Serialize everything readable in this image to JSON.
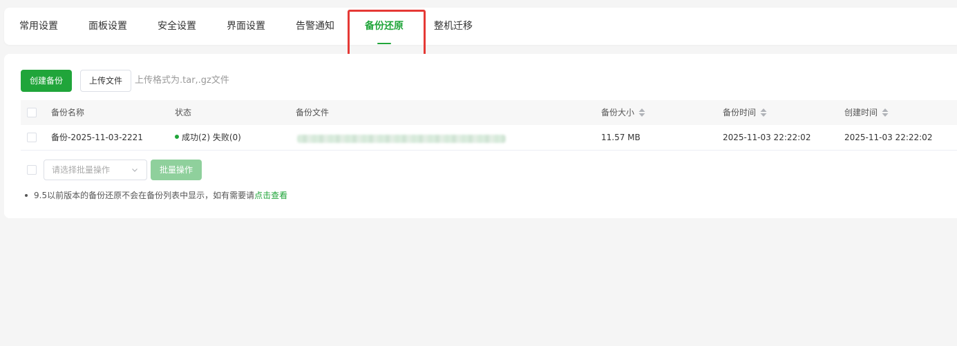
{
  "tabs": [
    {
      "label": "常用设置"
    },
    {
      "label": "面板设置"
    },
    {
      "label": "安全设置"
    },
    {
      "label": "界面设置"
    },
    {
      "label": "告警通知"
    },
    {
      "label": "备份还原"
    },
    {
      "label": "整机迁移"
    }
  ],
  "active_tab": "备份还原",
  "toolbar": {
    "create_label": "创建备份",
    "upload_label": "上传文件",
    "upload_hint": "上传格式为.tar,.gz文件"
  },
  "table": {
    "columns": {
      "name": "备份名称",
      "status": "状态",
      "file": "备份文件",
      "size": "备份大小",
      "backup_time": "备份时间",
      "create_time": "创建时间"
    },
    "rows": [
      {
        "name": "备份-2025-11-03-2221",
        "status": "成功(2) 失败(0)",
        "size": "11.57 MB",
        "backup_time": "2025-11-03 22:22:02",
        "create_time": "2025-11-03 22:22:02"
      }
    ]
  },
  "batch": {
    "placeholder": "请选择批量操作",
    "button_label": "批量操作"
  },
  "note": {
    "text": "9.5以前版本的备份还原不会在备份列表中显示，如有需要请",
    "link": "点击查看"
  },
  "colors": {
    "accent": "#20a53a",
    "highlight": "#e53935"
  }
}
